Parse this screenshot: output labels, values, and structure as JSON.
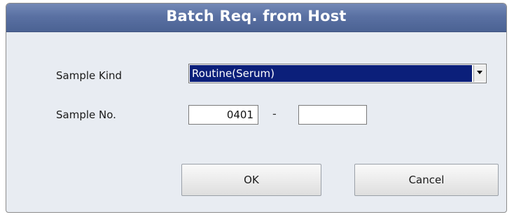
{
  "dialog": {
    "title": "Batch Req. from Host"
  },
  "form": {
    "sample_kind_label": "Sample Kind",
    "sample_kind_value": "Routine(Serum)",
    "sample_no_label": "Sample No.",
    "sample_no_from": "0401",
    "sample_no_separator": "-",
    "sample_no_to": ""
  },
  "buttons": {
    "ok_label": "OK",
    "cancel_label": "Cancel"
  },
  "icons": {
    "dropdown": "chevron-down-icon"
  },
  "colors": {
    "titlebar": "#5a71a3",
    "selection": "#0b1f7a",
    "dialog_bg": "#e8ecf2"
  }
}
